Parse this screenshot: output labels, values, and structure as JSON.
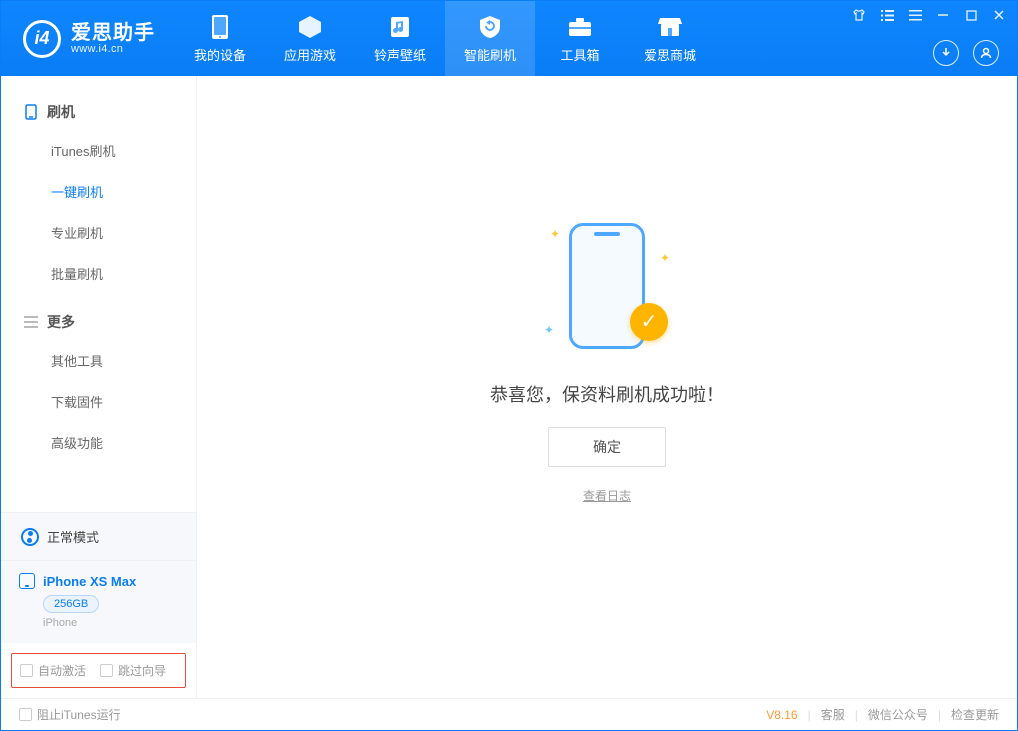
{
  "app": {
    "name_cn": "爱思助手",
    "name_en": "www.i4.cn"
  },
  "tabs": {
    "device": "我的设备",
    "apps": "应用游戏",
    "ringtones": "铃声壁纸",
    "flash": "智能刷机",
    "toolbox": "工具箱",
    "store": "爱思商城"
  },
  "sidebar": {
    "group_flash": "刷机",
    "items_flash": {
      "itunes": "iTunes刷机",
      "onekey": "一键刷机",
      "pro": "专业刷机",
      "batch": "批量刷机"
    },
    "group_more": "更多",
    "items_more": {
      "other": "其他工具",
      "firmware": "下载固件",
      "advanced": "高级功能"
    },
    "mode": "正常模式",
    "device_name": "iPhone XS Max",
    "storage": "256GB",
    "device_type": "iPhone",
    "opt_auto_activate": "自动激活",
    "opt_skip_wizard": "跳过向导"
  },
  "content": {
    "success": "恭喜您，保资料刷机成功啦！",
    "ok": "确定",
    "view_log": "查看日志"
  },
  "statusbar": {
    "block_itunes": "阻止iTunes运行",
    "version": "V8.16",
    "support": "客服",
    "wechat": "微信公众号",
    "update": "检查更新"
  }
}
